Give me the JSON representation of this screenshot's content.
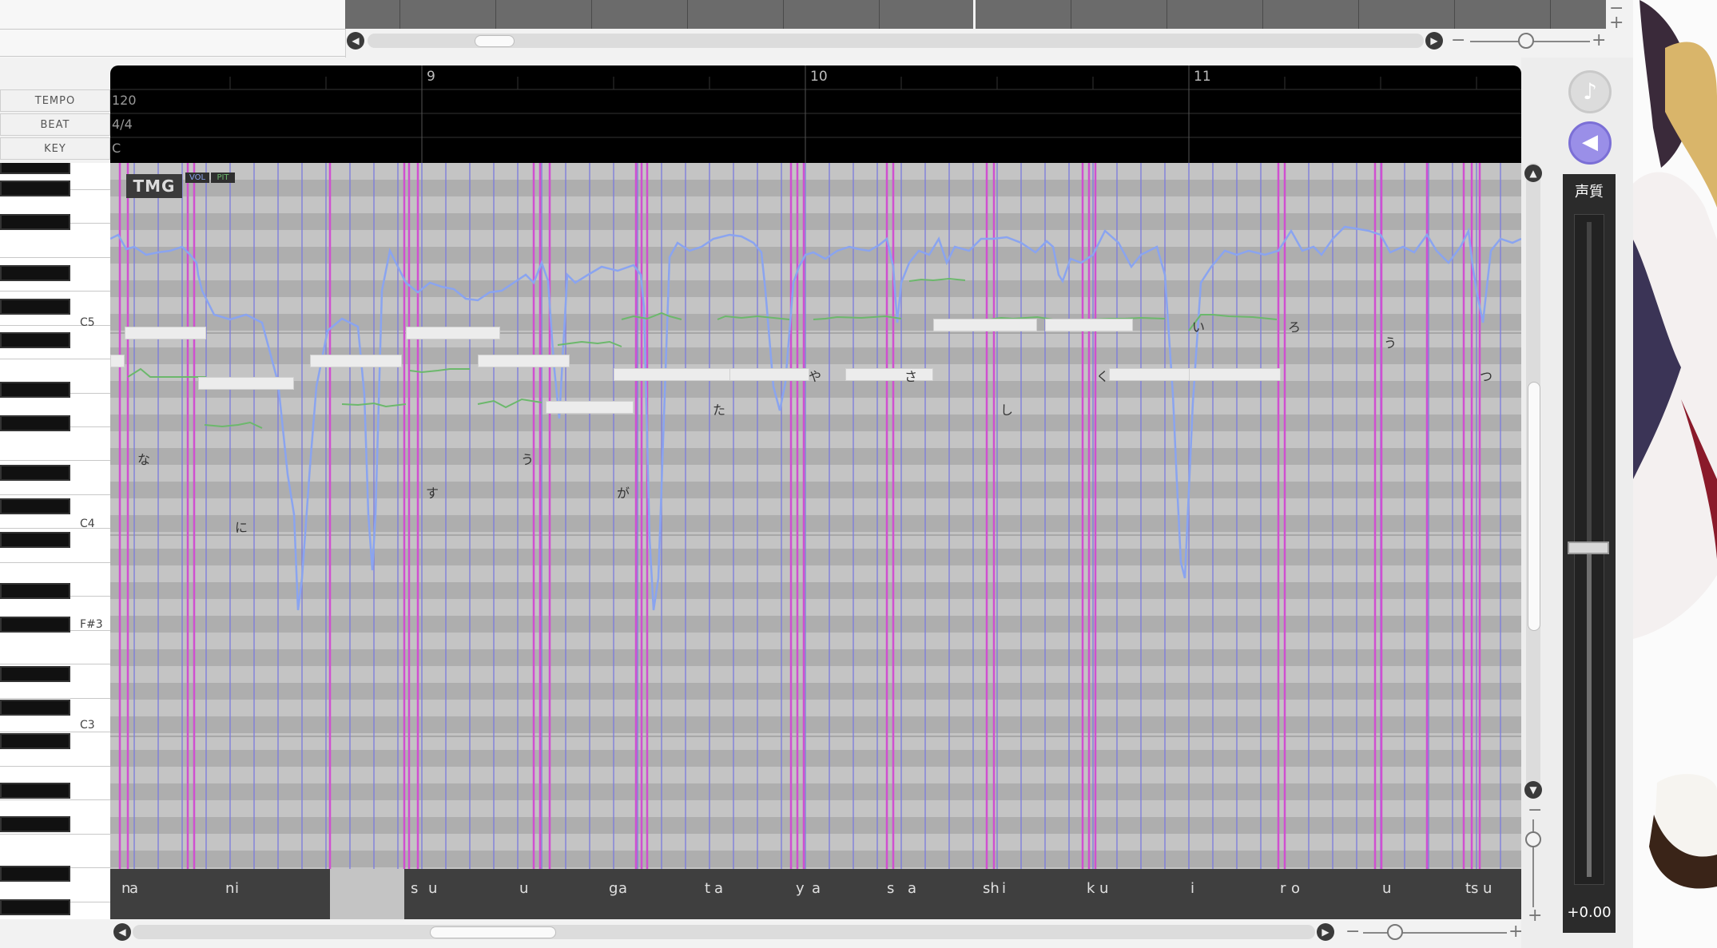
{
  "header_rows": {
    "tempo_label": "TEMPO",
    "beat_label": "BEAT",
    "key_label": "KEY",
    "tempo_value": "120",
    "beat_value": "4/4",
    "key_value": "C"
  },
  "measures": [
    "9",
    "10",
    "11"
  ],
  "piano": {
    "labels": [
      "C5",
      "C4",
      "F#3",
      "C3"
    ]
  },
  "track_badges": {
    "track_name": "TMG",
    "vol": "VOL",
    "pit": "PIT"
  },
  "lyrics": [
    "な",
    "に",
    "す",
    "う",
    "が",
    "た",
    "や",
    "さ",
    "し",
    "く",
    "い",
    "ろ",
    "う",
    "つ"
  ],
  "phonemes": [
    "n",
    "a",
    "n",
    "i",
    "s",
    "u",
    "u",
    "g",
    "a",
    "t",
    "a",
    "y",
    "a",
    "s",
    "a",
    "sh",
    "i",
    "k",
    "u",
    "i",
    "r",
    "o",
    "u",
    "ts",
    "u"
  ],
  "zoom": {
    "minus": "−",
    "plus": "+"
  },
  "voice_quality": {
    "label": "声質",
    "value": "+0.00"
  },
  "colors": {
    "phoneme_line": "#d050d0",
    "grid_line": "#7b7bdf",
    "pitch_curve": "#8aa4f0",
    "note_pitch": "#6cb86c",
    "accent_button": "#9a8fe8"
  },
  "icons": {
    "vocal_button": "music-note-icon",
    "speaker_button": "speaker-icon"
  }
}
